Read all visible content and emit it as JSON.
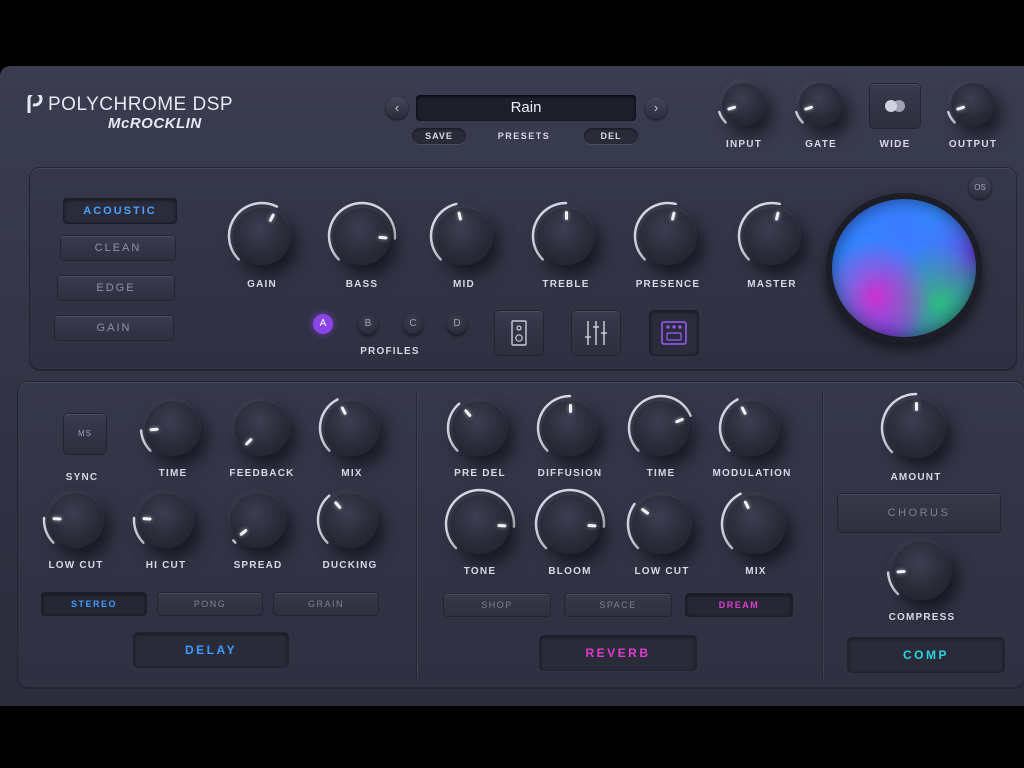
{
  "header": {
    "brand_name": "POLYCHROME DSP",
    "brand_sub": "McROCKLIN",
    "preset_name": "Rain",
    "prev_glyph": "‹",
    "next_glyph": "›",
    "save_label": "SAVE",
    "presets_label": "PRESETS",
    "del_label": "DEL",
    "input_label": "INPUT",
    "gate_label": "GATE",
    "wide_label": "WIDE",
    "output_label": "OUTPUT"
  },
  "amp": {
    "modes": [
      {
        "label": "ACOUSTIC",
        "active": true
      },
      {
        "label": "CLEAN",
        "active": false
      },
      {
        "label": "EDGE",
        "active": false
      },
      {
        "label": "GAIN",
        "active": false
      }
    ],
    "knobs": [
      {
        "label": "GAIN",
        "value": 0.6
      },
      {
        "label": "BASS",
        "value": 0.85
      },
      {
        "label": "MID",
        "value": 0.45
      },
      {
        "label": "TREBLE",
        "value": 0.5
      },
      {
        "label": "PRESENCE",
        "value": 0.55
      },
      {
        "label": "MASTER",
        "value": 0.55
      }
    ],
    "profiles": [
      {
        "label": "A",
        "active": true
      },
      {
        "label": "B",
        "active": false
      },
      {
        "label": "C",
        "active": false
      },
      {
        "label": "D",
        "active": false
      }
    ],
    "profiles_label": "PROFILES",
    "os_label": "OS"
  },
  "delay": {
    "sync_label": "MS",
    "sync_caption": "SYNC",
    "knobs_top": [
      {
        "label": "TIME",
        "value": 0.15
      },
      {
        "label": "FEEDBACK",
        "value": 0.0
      },
      {
        "label": "MIX",
        "value": 0.4
      }
    ],
    "knobs_bottom": [
      {
        "label": "LOW CUT",
        "value": 0.18
      },
      {
        "label": "HI CUT",
        "value": 0.18
      },
      {
        "label": "SPREAD",
        "value": 0.02
      },
      {
        "label": "DUCKING",
        "value": 0.35
      }
    ],
    "modes": [
      {
        "label": "STEREO",
        "active": true
      },
      {
        "label": "PONG",
        "active": false
      },
      {
        "label": "GRAIN",
        "active": false
      }
    ],
    "title": "DELAY"
  },
  "reverb": {
    "knobs_top": [
      {
        "label": "PRE DEL",
        "value": 0.35
      },
      {
        "label": "DIFFUSION",
        "value": 0.5
      },
      {
        "label": "TIME",
        "value": 0.75
      },
      {
        "label": "MODULATION",
        "value": 0.4
      }
    ],
    "knobs_bottom": [
      {
        "label": "TONE",
        "value": 0.85
      },
      {
        "label": "BLOOM",
        "value": 0.85
      },
      {
        "label": "LOW CUT",
        "value": 0.3
      },
      {
        "label": "MIX",
        "value": 0.4
      }
    ],
    "modes": [
      {
        "label": "SHOP",
        "active": false
      },
      {
        "label": "SPACE",
        "active": false
      },
      {
        "label": "DREAM",
        "active": true
      }
    ],
    "title": "REVERB"
  },
  "comp": {
    "amount_label": "AMOUNT",
    "amount_value": 0.5,
    "chorus_label": "CHORUS",
    "compress_label": "COMPRESS",
    "compress_value": 0.15,
    "title": "COMP"
  },
  "colors": {
    "delay_accent": "#3d9bff",
    "reverb_accent": "#e03bd0",
    "comp_accent": "#28d6e0",
    "profile_active": "#8a45e6"
  }
}
